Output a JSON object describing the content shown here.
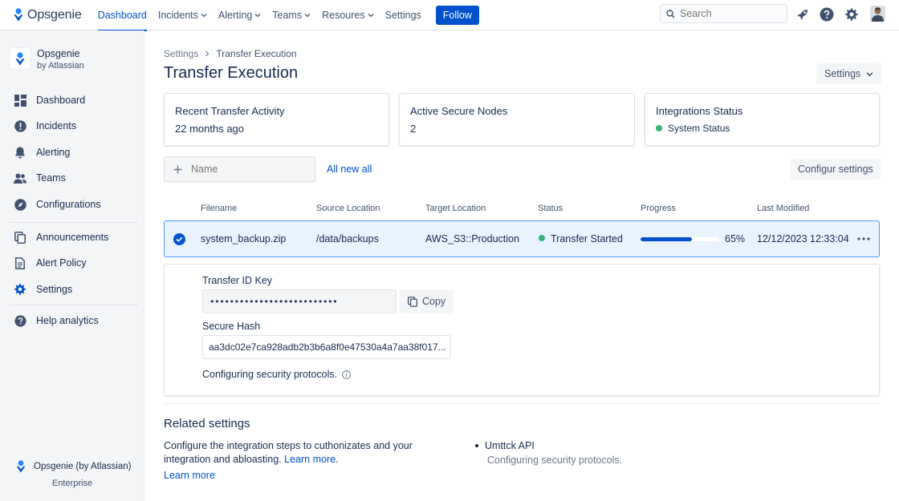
{
  "topnav": {
    "brand": "Opsgenie",
    "items": [
      {
        "label": "Dashboard",
        "active": true,
        "dropdown": false
      },
      {
        "label": "Incidents",
        "active": false,
        "dropdown": true
      },
      {
        "label": "Alerting",
        "active": false,
        "dropdown": true
      },
      {
        "label": "Teams",
        "active": false,
        "dropdown": true
      },
      {
        "label": "Resoures",
        "active": false,
        "dropdown": true
      },
      {
        "label": "Settings",
        "active": false,
        "dropdown": false
      }
    ],
    "follow_label": "Follow",
    "search_placeholder": "Search",
    "icons": [
      "rocket-icon",
      "help-icon",
      "gear-icon",
      "avatar"
    ]
  },
  "sidebar": {
    "brand_name": "Opsgenie",
    "brand_sub": "by Atlassian",
    "items": [
      {
        "label": "Dashboard",
        "icon": "dashboard-icon"
      },
      {
        "label": "Incidents",
        "icon": "incident-icon"
      },
      {
        "label": "Alerting",
        "icon": "bell-icon"
      },
      {
        "label": "Teams",
        "icon": "people-icon"
      },
      {
        "label": "Configurations",
        "icon": "compass-icon"
      },
      {
        "label": "Announcements",
        "icon": "copy-icon"
      },
      {
        "label": "Alert Policy",
        "icon": "document-icon"
      },
      {
        "label": "Settings",
        "icon": "gear-icon"
      },
      {
        "label": "Help analytics",
        "icon": "help-icon"
      }
    ],
    "footer_name": "Opsgenie (by Atlassian)",
    "footer_plan": "Enterprise"
  },
  "page": {
    "breadcrumb_parent": "Settings",
    "breadcrumb_current": "Transfer Execution",
    "title": "Transfer Execution",
    "settings_btn": "Settings"
  },
  "cards": [
    {
      "title": "Recent Transfer Activity",
      "value": "22 months ago"
    },
    {
      "title": "Active Secure Nodes",
      "value": "2"
    },
    {
      "title": "Integrations Status",
      "status": "System Status"
    }
  ],
  "toolbar": {
    "name_placeholder": "Name",
    "all_new_link": "All new all",
    "config_btn": "Configur settings"
  },
  "table": {
    "headers": [
      "Filename",
      "Source Location",
      "Target Location",
      "Status",
      "Progress",
      "Last Modified"
    ],
    "row": {
      "filename": "system_backup.zip",
      "source": "/data/backups",
      "target": "AWS_S3::Production",
      "status": "Transfer Started",
      "progress_value": 0.65,
      "progress_label": "65%",
      "modified": "12/12/2023 12:33:04"
    }
  },
  "detail": {
    "key_label": "Transfer ID Key",
    "key_value": "••••••••••••••••••••••••••",
    "copy_label": "Copy",
    "hash_label": "Secure Hash",
    "hash_value": "aa3dc02e7ca928adb2b3b6a8f0e47530a4a7aa38f017...",
    "note": "Configuring security protocols."
  },
  "related": {
    "title": "Related settings",
    "desc_text": "Configure the integration steps to cuthonizates and your integration and abloasting.",
    "desc_link": "Learn more.",
    "learn_more": "Learn more",
    "list": [
      {
        "title": "Umttck API",
        "sub": "Configuring security protocols."
      }
    ]
  },
  "colors": {
    "accent": "#0052cc",
    "success": "#36b37e",
    "row_selected_bg": "#e9f2ff",
    "sidebar_bg": "#f4f5f7"
  }
}
